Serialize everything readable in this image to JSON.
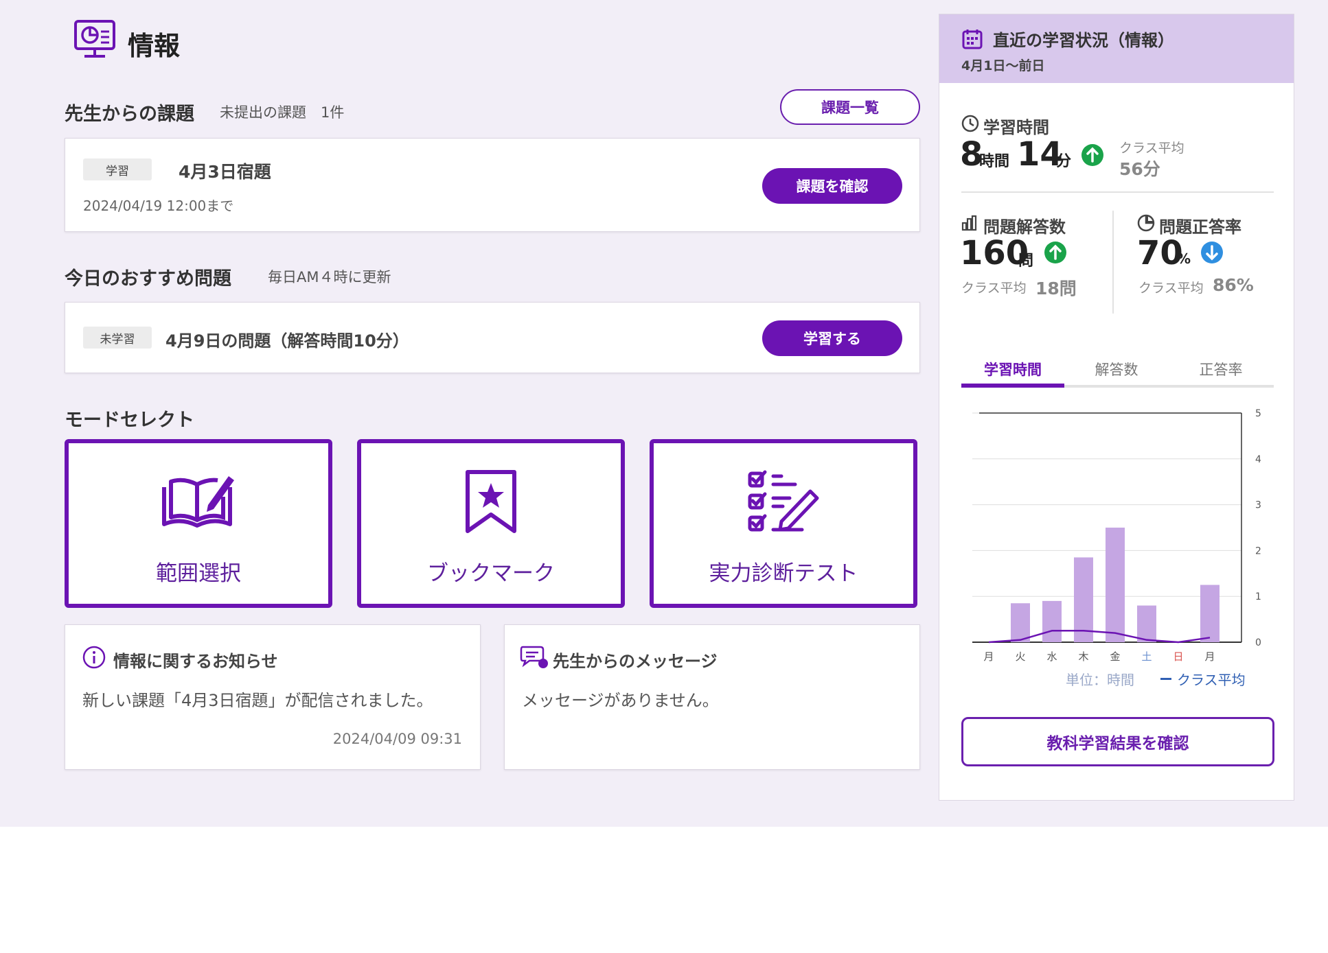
{
  "page": {
    "title": "情報"
  },
  "assignments": {
    "title": "先生からの課題",
    "pending": "未提出の課題　1件",
    "list_button": "課題一覧",
    "item": {
      "tag": "学習",
      "name": "4月3日宿題",
      "deadline": "2024/04/19 12:00まで",
      "button": "課題を確認"
    }
  },
  "recommend": {
    "title": "今日のおすすめ問題",
    "sub": "毎日AM４時に更新",
    "item": {
      "tag": "未学習",
      "name": "4月9日の問題（解答時間10分）",
      "button": "学習する"
    }
  },
  "mode_select": {
    "title": "モードセレクト",
    "modes": [
      {
        "label": "範囲選択",
        "icon": "open-book-pencil-icon"
      },
      {
        "label": "ブックマーク",
        "icon": "bookmark-star-icon"
      },
      {
        "label": "実力診断テスト",
        "icon": "checklist-pencil-icon"
      }
    ]
  },
  "notice": {
    "title": "情報に関するお知らせ",
    "text": "新しい課題「4月3日宿題」が配信されました。",
    "date": "2024/04/09 09:31"
  },
  "message": {
    "title": "先生からのメッセージ",
    "text": "メッセージがありません。"
  },
  "status": {
    "title": "直近の学習状況（情報）",
    "period": "4月1日〜前日",
    "study_time": {
      "label": "学習時間",
      "hours": "8",
      "hours_unit": "時間",
      "minutes": "14",
      "minutes_unit": "分",
      "avg_label": "クラス平均",
      "avg_value": "56分",
      "trend": "up"
    },
    "answers": {
      "label": "問題解答数",
      "value": "160",
      "unit": "問",
      "avg_label": "クラス平均",
      "avg_value": "18問",
      "trend": "up"
    },
    "accuracy": {
      "label": "問題正答率",
      "value": "70",
      "unit": "%",
      "avg_label": "クラス平均",
      "avg_value": "86%",
      "trend": "down"
    },
    "tabs": [
      "学習時間",
      "解答数",
      "正答率"
    ],
    "active_tab": "学習時間",
    "unit_text": "単位：時間",
    "legend_text": "クラス平均",
    "result_button": "教科学習結果を確認"
  },
  "chart_data": {
    "type": "bar",
    "categories": [
      "月",
      "火",
      "水",
      "木",
      "金",
      "土",
      "日",
      "月"
    ],
    "series": [
      {
        "values": [
          0,
          0.85,
          0.9,
          1.85,
          2.5,
          0.8,
          0,
          1.25
        ]
      },
      {
        "name": "クラス平均",
        "type": "line",
        "values": [
          0,
          0.05,
          0.25,
          0.25,
          0.2,
          0.05,
          0,
          0.1
        ]
      }
    ],
    "ylim": [
      0,
      5
    ],
    "yticks": [
      0,
      1,
      2,
      3,
      4,
      5
    ],
    "ylabel": "単位：時間",
    "colors": {
      "bar": "#c5a6e3",
      "line": "#6b13b3",
      "weekend_sat": "#6a8fcf",
      "weekend_sun": "#d9534f"
    }
  },
  "colors": {
    "accent": "#6b13b3",
    "background": "#f2eef7",
    "up": "#1aa34a",
    "down": "#2f8fe0"
  }
}
